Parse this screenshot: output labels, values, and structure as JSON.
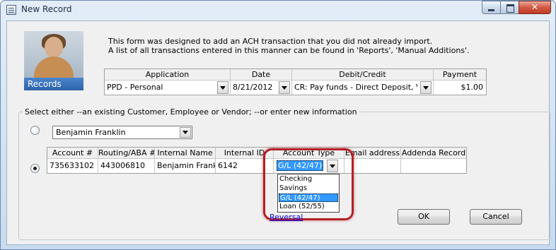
{
  "window": {
    "title": "New Record"
  },
  "records_label": "Records",
  "info": {
    "line1": "This form was designed to add an ACH transaction that you did not already import.",
    "line2": "A list of all transactions entered in this manner can be found in 'Reports', 'Manual Additions'."
  },
  "transaction": {
    "headers": [
      "Application",
      "Date",
      "Debit/Credit",
      "Payment"
    ],
    "application": "PPD - Personal",
    "date": "8/21/2012",
    "debit_credit": "CR: Pay funds - Direct Deposit, Venc",
    "payment": "$1.00"
  },
  "entity": {
    "legend": "Select either --an existing Customer, Employee or Vendor;  --or enter new information",
    "existing_value": "Benjamin Franklin",
    "existing_selected": false,
    "new_selected": true
  },
  "new_info": {
    "headers": [
      "Account #",
      "Routing/ABA #",
      "Internal Name",
      "Internal ID",
      "Account Type",
      "Email address",
      "Addenda Record"
    ],
    "account_number": "735633102",
    "routing": "443006810",
    "internal_name": "Benjamin Franklin",
    "internal_id": "6142",
    "account_type": "G/L (42/47)",
    "email": "",
    "addenda": ""
  },
  "account_type_options": [
    "Checking",
    "Savings",
    "G/L (42/47)",
    "Loan (52/55)"
  ],
  "account_type_selected_index": 2,
  "reversal_label": "Reversal",
  "buttons": {
    "ok": "OK",
    "cancel": "Cancel"
  },
  "colors": {
    "highlight_ring": "#b32024",
    "selection": "#3399ff",
    "link": "#0000ee"
  },
  "icons": [
    "app-icon",
    "minimize-icon",
    "maximize-icon",
    "close-icon",
    "chevron-down-icon",
    "records-photo"
  ]
}
